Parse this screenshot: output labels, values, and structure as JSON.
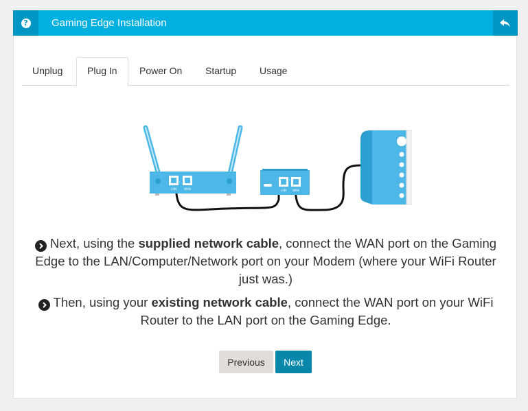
{
  "header": {
    "title": "Gaming Edge Installation",
    "help_glyph": "?",
    "accent": "#00b0e0",
    "accent_dark": "#0096c4"
  },
  "tabs": [
    {
      "label": "Unplug",
      "active": false
    },
    {
      "label": "Plug In",
      "active": true
    },
    {
      "label": "Power On",
      "active": false
    },
    {
      "label": "Startup",
      "active": false
    },
    {
      "label": "Usage",
      "active": false
    }
  ],
  "illustration": {
    "router_ports": [
      "LAN",
      "WAN"
    ],
    "edge_ports": [
      "LAN",
      "WAN"
    ],
    "device_color": "#4db8e8"
  },
  "instructions": [
    {
      "pre": "Next, using the ",
      "bold": "supplied network cable",
      "post": ", connect the WAN port on the Gaming Edge to the LAN/Computer/Network port on your Modem (where your WiFi Router just was.)"
    },
    {
      "pre": "Then, using your ",
      "bold": "existing network cable",
      "post": ", connect the WAN port on your WiFi Router to the LAN port on the Gaming Edge."
    }
  ],
  "buttons": {
    "previous": "Previous",
    "next": "Next"
  }
}
